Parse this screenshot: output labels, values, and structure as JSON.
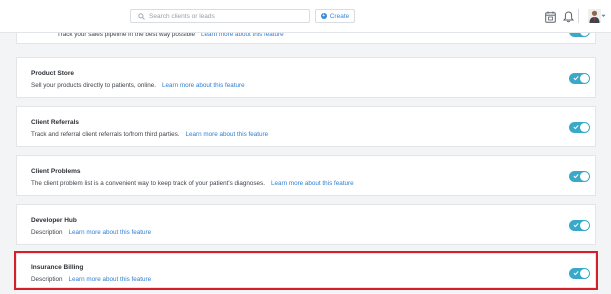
{
  "topbar": {
    "search_placeholder": "Search clients or leads",
    "create_label": "Create"
  },
  "features": [
    {
      "title": "",
      "description": "Track your sales pipeline in the best way possible",
      "link": "Learn more about this feature",
      "enabled": true
    },
    {
      "title": "Product Store",
      "description": "Sell your products directly to patients, online.",
      "link": "Learn more about this feature",
      "enabled": true
    },
    {
      "title": "Client Referrals",
      "description": "Track and referral client referrals to/from third parties.",
      "link": "Learn more about this feature",
      "enabled": true
    },
    {
      "title": "Client Problems",
      "description": "The client problem list is a convenient way to keep track of your patient's diagnoses.",
      "link": "Learn more about this feature",
      "enabled": true
    },
    {
      "title": "Developer Hub",
      "description": "Description",
      "link": "Learn more about this feature",
      "enabled": true
    },
    {
      "title": "Insurance Billing",
      "description": "Description",
      "link": "Learn more about this feature",
      "enabled": true,
      "highlighted": true
    }
  ],
  "colors": {
    "toggle_on": "#3aa8c7",
    "link": "#2f7fd1",
    "highlight": "#d51f2b"
  },
  "icons": [
    "search-icon",
    "plus-icon",
    "calendar-icon",
    "bell-icon",
    "avatar",
    "chevron-down-icon",
    "pipeline-icon",
    "check-icon"
  ]
}
